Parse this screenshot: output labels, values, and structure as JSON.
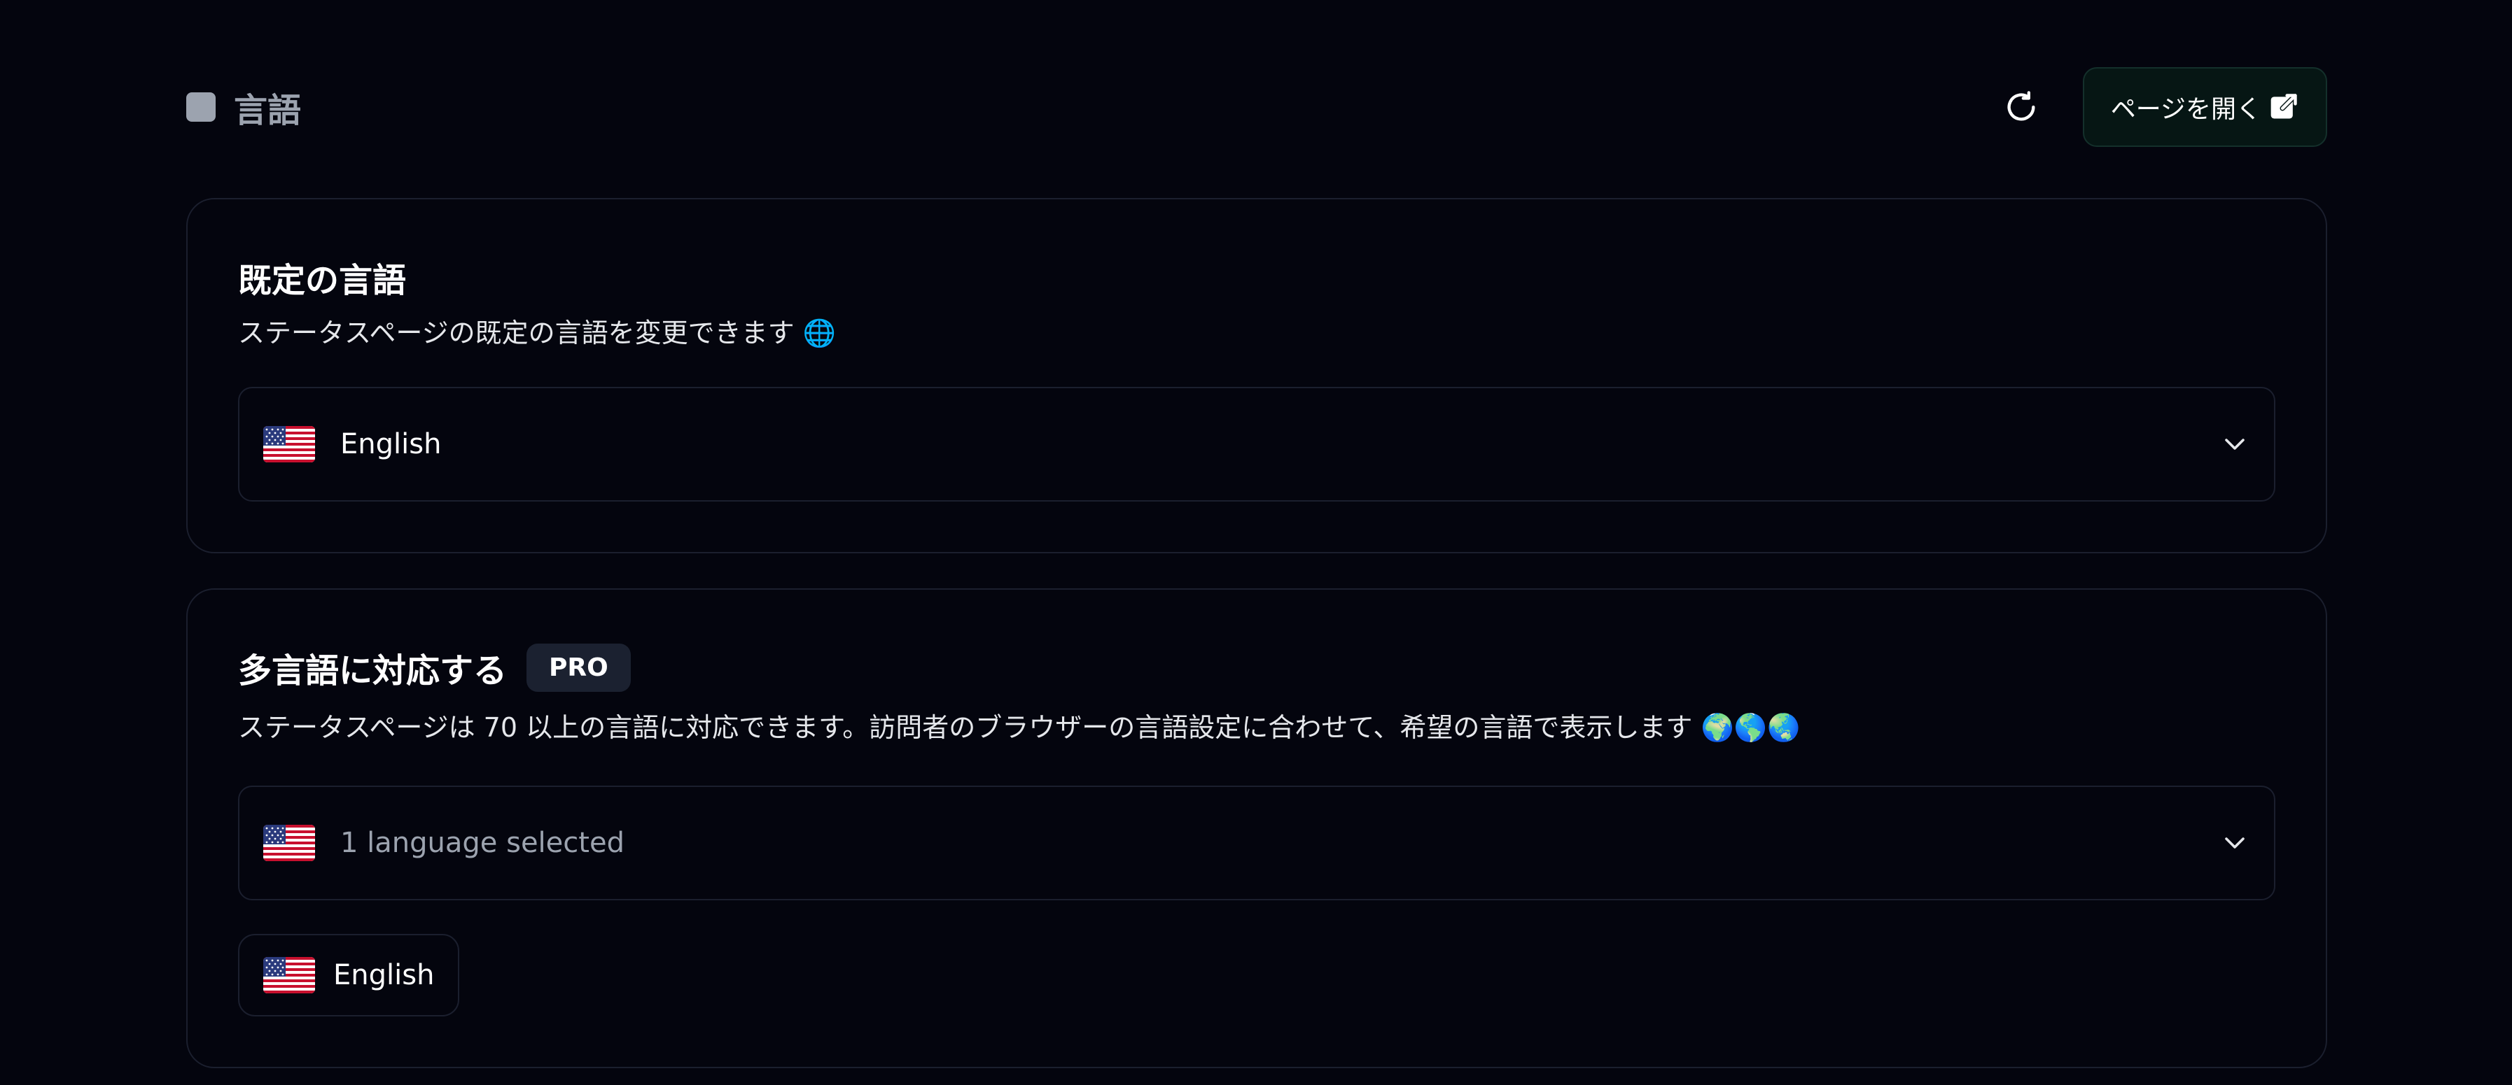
{
  "header": {
    "title": "言語",
    "open_page_label": "ページを開く"
  },
  "default_language": {
    "heading": "既定の言語",
    "description": "ステータスページの既定の言語を変更できます 🌐",
    "selected_value": "English",
    "flag_icon": "us-flag-icon"
  },
  "multi_language": {
    "heading": "多言語に対応する",
    "badge": "PRO",
    "description": "ステータスページは 70 以上の言語に対応できます。訪問者のブラウザーの言語設定に合わせて、希望の言語で表示します 🌍🌎🌏",
    "select_summary": "1 language selected",
    "selected_chips": [
      {
        "label": "English",
        "flag_icon": "us-flag-icon"
      }
    ]
  },
  "colors": {
    "background": "#04050e",
    "border": "#1b1f2e",
    "muted_text": "#9ca3af",
    "button_bg": "#061614",
    "badge_bg": "#1b2130"
  }
}
